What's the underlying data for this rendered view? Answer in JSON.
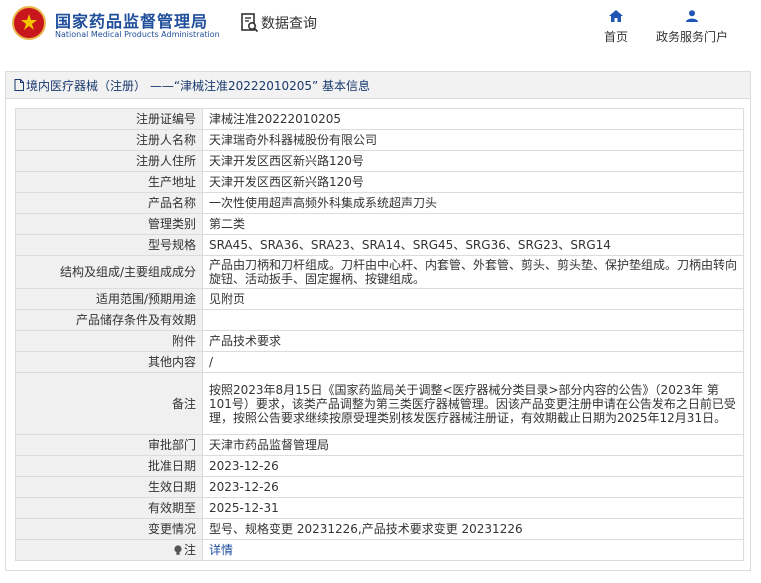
{
  "header": {
    "logo_cn": "国家药品监督管理局",
    "logo_en": "National Medical Products Administration",
    "query_label": "数据查询",
    "nav_home": "首页",
    "nav_portal": "政务服务门户"
  },
  "panel": {
    "title": "境内医疗器械（注册） ——“津械注准20222010205” 基本信息"
  },
  "rows": [
    {
      "label": "注册证编号",
      "value": "津械注准20222010205"
    },
    {
      "label": "注册人名称",
      "value": "天津瑞奇外科器械股份有限公司"
    },
    {
      "label": "注册人住所",
      "value": "天津开发区西区新兴路120号"
    },
    {
      "label": "生产地址",
      "value": "天津开发区西区新兴路120号"
    },
    {
      "label": "产品名称",
      "value": "一次性使用超声高频外科集成系统超声刀头"
    },
    {
      "label": "管理类别",
      "value": "第二类"
    },
    {
      "label": "型号规格",
      "value": "SRA45、SRA36、SRA23、SRA14、SRG45、SRG36、SRG23、SRG14"
    },
    {
      "label": "结构及组成/主要组成成分",
      "value": "产品由刀柄和刀杆组成。刀杆由中心杆、内套管、外套管、剪头、剪头垫、保护垫组成。刀柄由转向旋钮、活动扳手、固定握柄、按键组成。"
    },
    {
      "label": "适用范围/预期用途",
      "value": "见附页"
    },
    {
      "label": "产品储存条件及有效期",
      "value": ""
    },
    {
      "label": "附件",
      "value": "产品技术要求"
    },
    {
      "label": "其他内容",
      "value": "/"
    },
    {
      "label": "备注",
      "value": "按照2023年8月15日《国家药监局关于调整<医疗器械分类目录>部分内容的公告》（2023年 第101号）要求，该类产品调整为第三类医疗器械管理。因该产品变更注册申请在公告发布之日前已受理，按照公告要求继续按原受理类别核发医疗器械注册证，有效期截止日期为2025年12月31日。"
    },
    {
      "label": "审批部门",
      "value": "天津市药品监督管理局"
    },
    {
      "label": "批准日期",
      "value": "2023-12-26"
    },
    {
      "label": "生效日期",
      "value": "2023-12-26"
    },
    {
      "label": "有效期至",
      "value": "2025-12-31"
    },
    {
      "label": "变更情况",
      "value": "型号、规格变更 20231226,产品技术要求变更 20231226"
    },
    {
      "label": "注",
      "value": "详情"
    }
  ]
}
